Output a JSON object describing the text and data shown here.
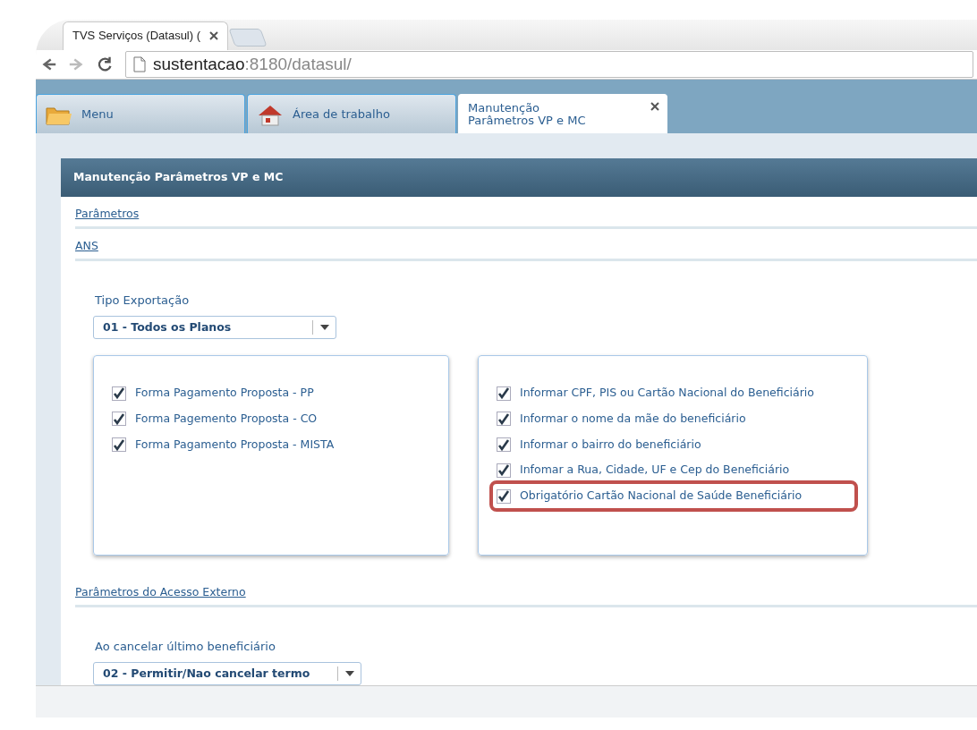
{
  "browser": {
    "tabs": [
      {
        "title": "TVS Serviços (Datasul) ("
      }
    ],
    "url": {
      "host": "sustentacao",
      "path": ":8180/datasul/"
    }
  },
  "app_tabs": [
    {
      "label": "Menu",
      "kind": "folder",
      "selected": false,
      "closable": false
    },
    {
      "label": "Área de trabalho",
      "kind": "home",
      "selected": false,
      "closable": false
    },
    {
      "label": "Manutenção\nParâmetros VP e MC",
      "kind": "page",
      "selected": true,
      "closable": true
    }
  ],
  "panel": {
    "title": "Manutenção Parâmetros VP e MC",
    "sections": [
      {
        "title": "Parâmetros",
        "kind": "link"
      },
      {
        "title": "ANS",
        "kind": "ans",
        "field": {
          "label": "Tipo Exportação",
          "value": "01 - Todos os Planos"
        },
        "groups": [
          [
            {
              "label": "Forma Pagamento Proposta - PP",
              "checked": true,
              "highlighted": false
            },
            {
              "label": "Forma Pagemento Proposta - CO",
              "checked": true,
              "highlighted": false
            },
            {
              "label": "Forma Pagamento Proposta - MISTA",
              "checked": true,
              "highlighted": false
            }
          ],
          [
            {
              "label": "Informar CPF, PIS ou Cartão Nacional do Beneficiário",
              "checked": true,
              "highlighted": false
            },
            {
              "label": "Informar o nome da mãe do beneficiário",
              "checked": true,
              "highlighted": false
            },
            {
              "label": "Informar o bairro do beneficiário",
              "checked": true,
              "highlighted": false
            },
            {
              "label": "Infomar a Rua, Cidade, UF e Cep do Beneficiário",
              "checked": true,
              "highlighted": false
            },
            {
              "label": "Obrigatório Cartão Nacional de Saúde Beneficiário",
              "checked": true,
              "highlighted": true
            }
          ]
        ]
      },
      {
        "title": "Parâmetros do Acesso Externo",
        "kind": "external",
        "field": {
          "label": "Ao cancelar último beneficiário",
          "value": "02 - Permitir/Nao cancelar termo"
        }
      }
    ]
  }
}
